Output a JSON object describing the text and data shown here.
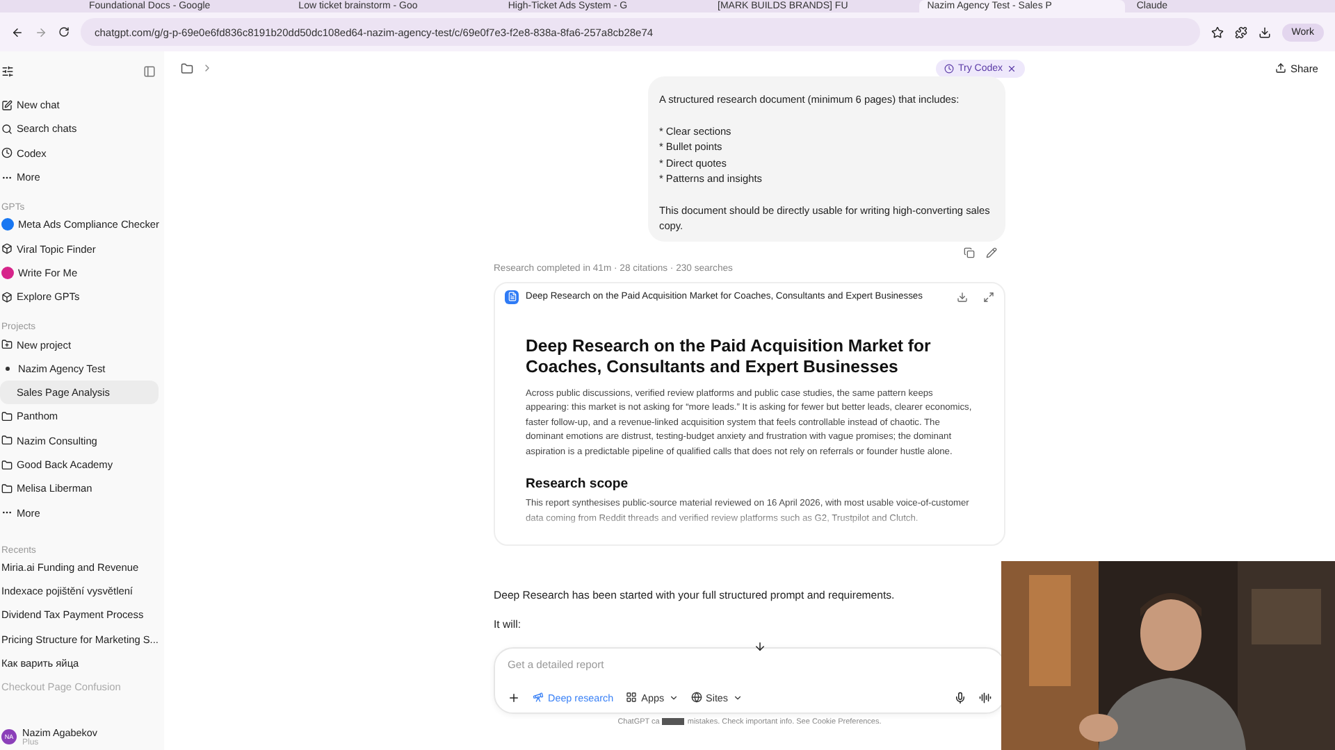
{
  "browser": {
    "tabs": [
      {
        "title": "Foundational Docs - Google",
        "selected": false
      },
      {
        "title": "Low ticket brainstorm - Goo",
        "selected": false
      },
      {
        "title": "High-Ticket Ads System - G",
        "selected": false
      },
      {
        "title": "[MARK BUILDS BRANDS] FU",
        "selected": false
      },
      {
        "title": "Nazim Agency Test - Sales P",
        "selected": true
      },
      {
        "title": "Claude",
        "selected": false
      }
    ],
    "url": "chatgpt.com/g/g-p-69e0e6fd836c8191b20dd50dc108ed64-nazim-agency-test/c/69e0f7e3-f2e8-838a-8fa6-257a8cb28e74",
    "profile": "Work"
  },
  "sidebar": {
    "top_items": [
      {
        "label": "New chat"
      },
      {
        "label": "Search chats"
      },
      {
        "label": "Codex"
      },
      {
        "label": "More"
      }
    ],
    "gpts_heading": "GPTs",
    "gpts": [
      {
        "label": "Meta Ads Compliance Checker",
        "color": "#1877f2"
      },
      {
        "label": "Viral Topic Finder"
      },
      {
        "label": "Write For Me",
        "color": "#d6248a"
      },
      {
        "label": "Explore GPTs"
      }
    ],
    "projects_heading": "Projects",
    "projects": [
      {
        "label": "New project",
        "kind": "new"
      },
      {
        "label": "Nazim Agency Test",
        "kind": "project",
        "expanded": true,
        "children": [
          {
            "label": "Sales Page Analysis",
            "selected": true
          }
        ]
      },
      {
        "label": "Panthom",
        "kind": "project",
        "expanded": false
      },
      {
        "label": "Nazim Consulting",
        "kind": "project",
        "expanded": false
      },
      {
        "label": "Good Back Academy",
        "kind": "project",
        "expanded": false
      },
      {
        "label": "Melisa Liberman",
        "kind": "project",
        "expanded": false
      },
      {
        "label": "More",
        "kind": "more"
      }
    ],
    "recents_heading": "Recents",
    "recents": [
      {
        "label": "Miria.ai Funding and Revenue",
        "dimmed": false
      },
      {
        "label": "Indexace pojištění vysvětlení",
        "dimmed": false
      },
      {
        "label": "Dividend Tax Payment Process",
        "dimmed": false
      },
      {
        "label": "Pricing Structure for Marketing S...",
        "dimmed": false
      },
      {
        "label": "Как варить яйца",
        "dimmed": false
      },
      {
        "label": "Checkout Page Confusion",
        "dimmed": true
      }
    ],
    "user": {
      "initials": "NA",
      "name": "Nazim Agabekov",
      "plan": "Plus"
    }
  },
  "header": {
    "pill": "Try Codex",
    "share": "Share"
  },
  "user_message": {
    "paragraphs": [
      "A structured research document (minimum 6 pages) that includes:"
    ],
    "bullets": [
      "* Clear sections",
      "* Bullet points",
      "* Direct quotes",
      "* Patterns and insights"
    ],
    "closing": "This document should be directly usable for writing high-converting sales copy."
  },
  "research_status": "Research completed in 41m · 28 citations · 230 searches",
  "report": {
    "card_title": "Deep Research on the Paid Acquisition Market for Coaches, Consultants and Expert Businesses",
    "heading": "Deep Research on the Paid Acquisition Market for Coaches, Consultants and Expert Businesses",
    "intro": "Across public discussions, verified review platforms and public case studies, the same pattern keeps appearing: this market is not asking for “more leads.” It is asking for fewer but better leads, clearer economics, faster follow-up, and a revenue-linked acquisition system that feels controllable instead of chaotic. The dominant emotions are distrust, testing-budget anxiety and frustration with vague promises; the dominant aspiration is a predictable pipeline of qualified calls that does not rely on referrals or founder hustle alone.",
    "section_heading": "Research scope",
    "section_text": "This report synthesises public-source material reviewed on 16 April 2026, with most usable voice-of-customer data coming from Reddit threads and verified review platforms such as G2, Trustpilot and Clutch."
  },
  "assistant_lines": [
    "Deep Research has been started with your full structured prompt and requirements.",
    "It will:"
  ],
  "composer": {
    "placeholder": "Get a detailed report",
    "tools": [
      {
        "label": "Deep research",
        "kind": "active"
      },
      {
        "label": "Apps",
        "kind": "menu"
      },
      {
        "label": "Sites",
        "kind": "menu"
      }
    ]
  },
  "footer": {
    "before": "ChatGPT ca",
    "after": "mistakes. Check important info. See Cookie Preferences."
  },
  "webcam": {
    "kind": "picture"
  }
}
